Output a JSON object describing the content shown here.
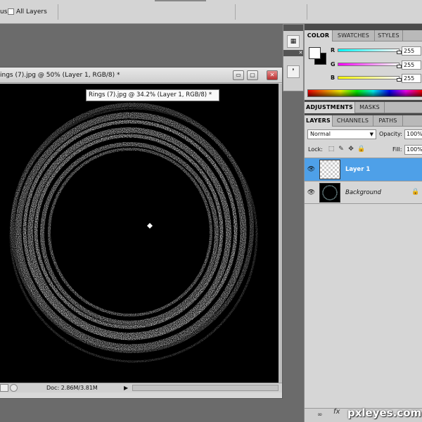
{
  "options_bar": {
    "left_fragment": "us",
    "all_layers_label": "All Layers"
  },
  "document": {
    "title": "ings (7).jpg @ 50% (Layer 1, RGB/8) *",
    "tooltip": "Rings (7).jpg @ 34.2% (Layer 1, RGB/8) *",
    "status_doc": "Doc: 2.86M/3.81M"
  },
  "window_buttons": {
    "minimize": "▭",
    "maximize": "▢",
    "close": "✕"
  },
  "color_panel": {
    "tabs": [
      "COLOR",
      "SWATCHES",
      "STYLES"
    ],
    "foreground": "#ffffff",
    "background": "#000000",
    "channels": [
      {
        "label": "R",
        "value": "255",
        "gradient": "linear-gradient(to right, #00ffff, #ffffff)"
      },
      {
        "label": "G",
        "value": "255",
        "gradient": "linear-gradient(to right, #ff00ff, #ffffff)"
      },
      {
        "label": "B",
        "value": "255",
        "gradient": "linear-gradient(to right, #ffff00, #ffffff)"
      }
    ]
  },
  "adjustments_panel": {
    "tabs": [
      "ADJUSTMENTS",
      "MASKS"
    ]
  },
  "layers_panel": {
    "tabs": [
      "LAYERS",
      "CHANNELS",
      "PATHS"
    ],
    "blend_mode": "Normal",
    "opacity_label": "Opacity:",
    "opacity_value": "100%",
    "lock_label": "Lock:",
    "fill_label": "Fill:",
    "fill_value": "100%",
    "layers": [
      {
        "name": "Layer 1",
        "selected": true
      },
      {
        "name": "Background",
        "selected": false
      }
    ]
  },
  "footer": {
    "fx_label": "fx"
  },
  "watermark": "pxleyes.com"
}
